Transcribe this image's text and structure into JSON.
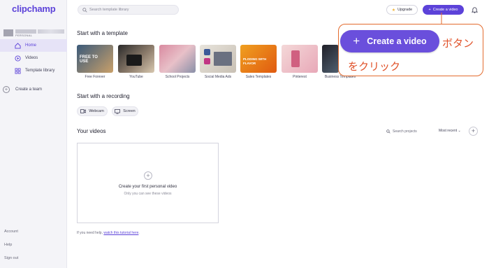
{
  "brand": "clipchamp",
  "workspace": {
    "label": "PERSONAL"
  },
  "sidebar": {
    "items": [
      {
        "label": "Home",
        "icon": "home-icon",
        "active": true
      },
      {
        "label": "Videos",
        "icon": "video-icon",
        "active": false
      },
      {
        "label": "Template library",
        "icon": "grid-icon",
        "active": false
      }
    ],
    "team_label": "Create a team",
    "bottom": [
      "Account",
      "Help",
      "Sign out"
    ]
  },
  "header": {
    "search_placeholder": "Search template library",
    "upgrade_label": "Upgrade",
    "create_label": "Create a video"
  },
  "templates": {
    "title": "Start with a template",
    "items": [
      {
        "label": "Free Forever",
        "overlay": "FREE TO USE"
      },
      {
        "label": "YouTube",
        "overlay": ""
      },
      {
        "label": "School Projects",
        "overlay": ""
      },
      {
        "label": "Social Media Ads",
        "overlay": ""
      },
      {
        "label": "Sales Templates",
        "overlay": "PLODING WITH FLAVOR"
      },
      {
        "label": "Pinterest",
        "overlay": ""
      },
      {
        "label": "Business Templates",
        "overlay": ""
      }
    ]
  },
  "recording": {
    "title": "Start with a recording",
    "webcam_label": "Webcam",
    "screen_label": "Screen"
  },
  "videos": {
    "title": "Your videos",
    "search_label": "Search projects",
    "sort_label": "Most recent",
    "empty_title": "Create your first personal video",
    "empty_sub": "Only you can see these videos",
    "help_prefix": "If you need help, ",
    "help_link": "watch this tutorial here",
    "help_suffix": "."
  },
  "callout": {
    "button_label": "Create a video",
    "text1": "ボタン",
    "text2": "をクリック"
  },
  "colors": {
    "accent": "#5c42d9",
    "callout": "#e0522a"
  }
}
